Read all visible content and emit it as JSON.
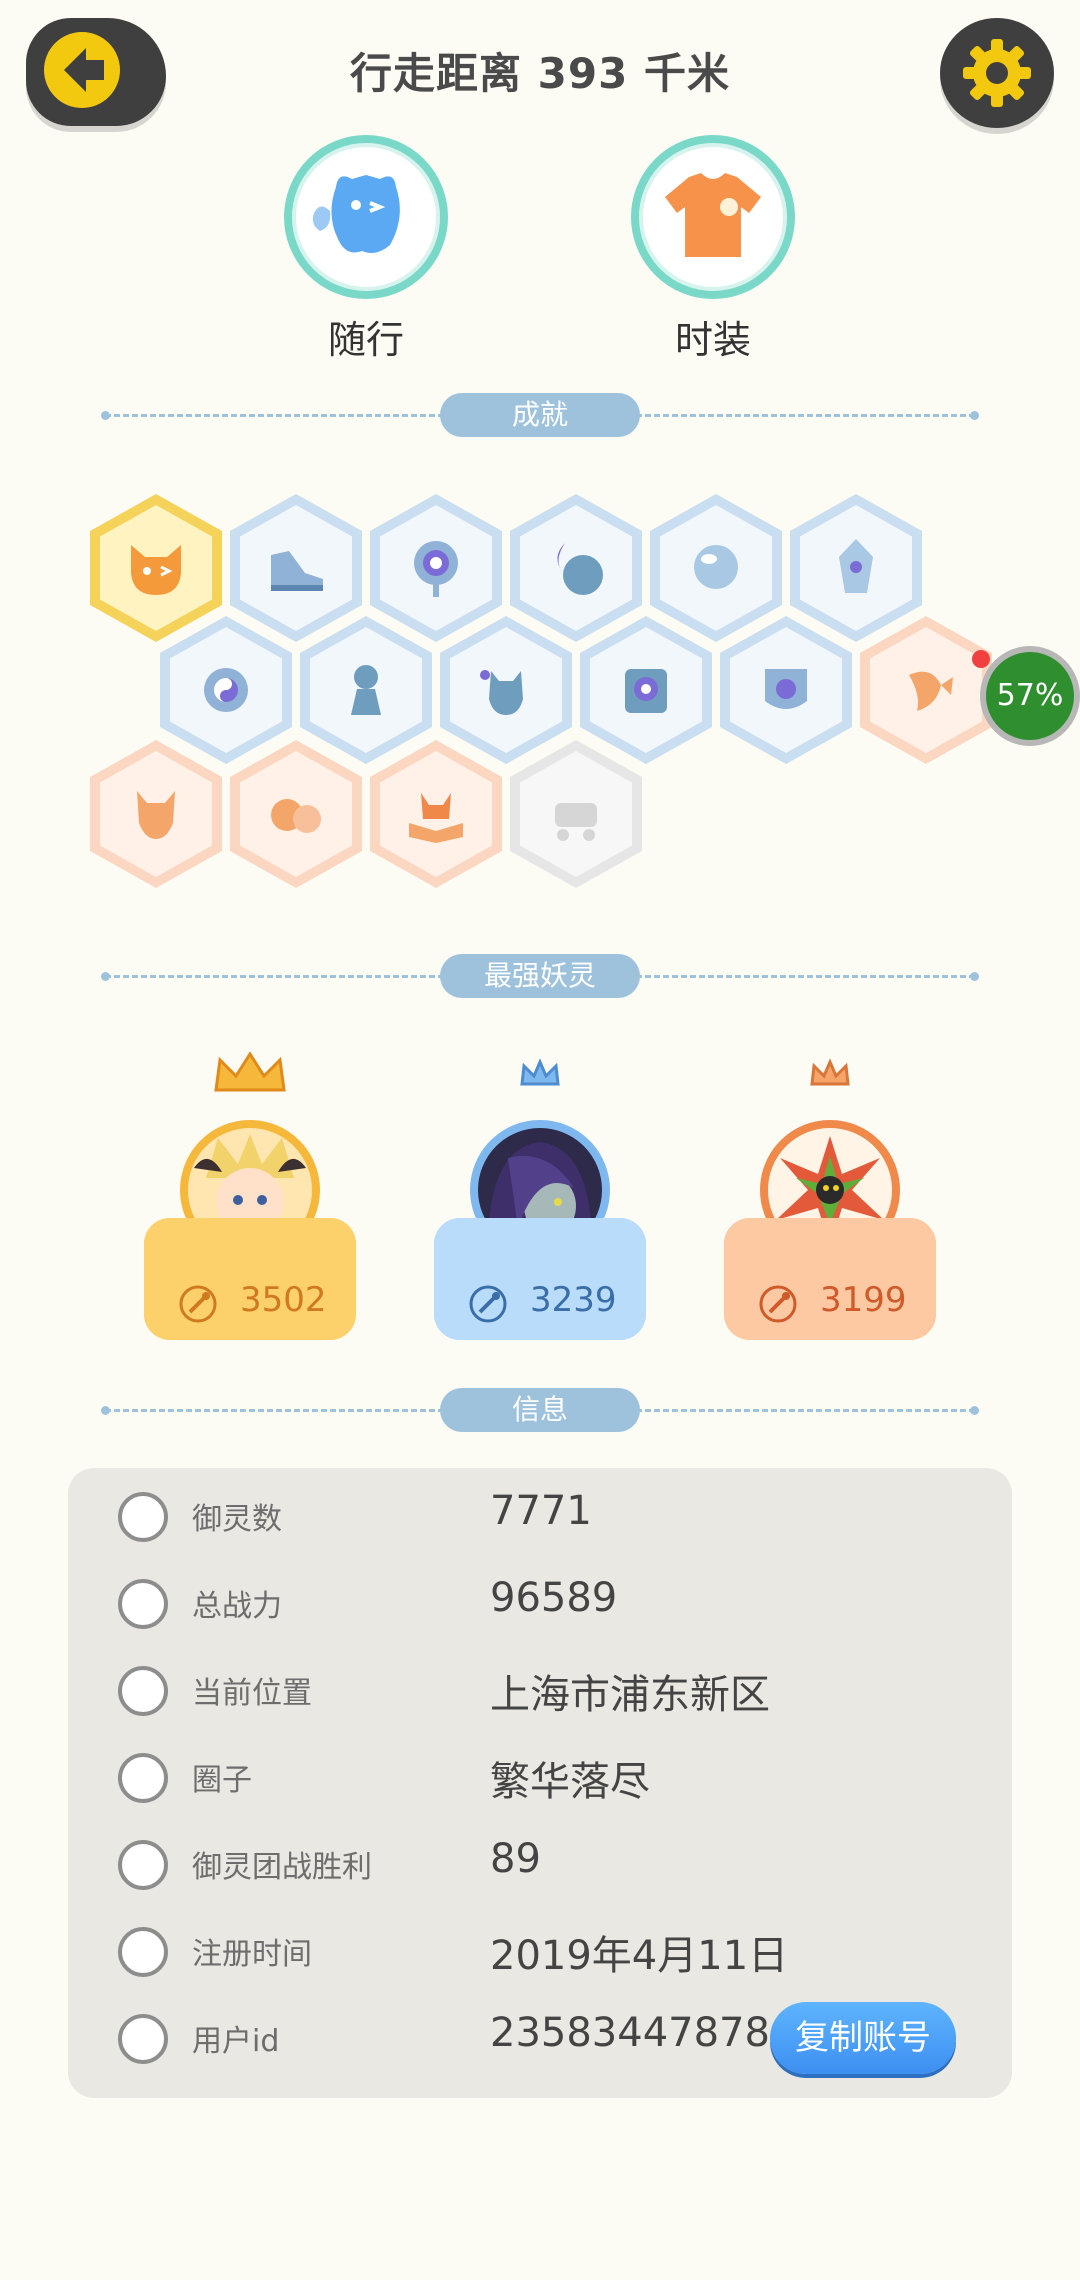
{
  "header": {
    "title": "行走距离 393 千米",
    "back_icon": "arrow-left-icon",
    "settings_icon": "gear-icon"
  },
  "top_items": [
    {
      "label": "随行",
      "icon": "companion-ghost-icon"
    },
    {
      "label": "时装",
      "icon": "tshirt-icon"
    }
  ],
  "sections": {
    "achievements": "成就",
    "strongest": "最强妖灵",
    "info": "信息"
  },
  "achievements": {
    "progress": "57%",
    "rows": [
      [
        "gold",
        "blue",
        "blue",
        "blue",
        "blue",
        "blue"
      ],
      [
        "blue",
        "blue",
        "blue",
        "blue",
        "blue",
        "peach"
      ],
      [
        "peach",
        "peach",
        "peach",
        "grey"
      ]
    ]
  },
  "spirits": [
    {
      "power": "3502",
      "theme": "gold"
    },
    {
      "power": "3239",
      "theme": "blue"
    },
    {
      "power": "3199",
      "theme": "orange"
    }
  ],
  "info": {
    "rows": [
      {
        "label": "御灵数",
        "value": "7771",
        "icon": "spirit-count-icon"
      },
      {
        "label": "总战力",
        "value": "96589",
        "icon": "sword-icon"
      },
      {
        "label": "当前位置",
        "value": "上海市浦东新区",
        "icon": "location-pin-icon"
      },
      {
        "label": "圈子",
        "value": "繁华落尽",
        "icon": "circle-target-icon"
      },
      {
        "label": "御灵团战胜利",
        "value": "89",
        "icon": "trophy-figure-icon"
      },
      {
        "label": "注册时间",
        "value": "2019年4月11日",
        "icon": "clock-icon"
      },
      {
        "label": "用户id",
        "value": "23583447878",
        "icon": "id-card-icon"
      }
    ],
    "copy_button": "复制账号"
  }
}
